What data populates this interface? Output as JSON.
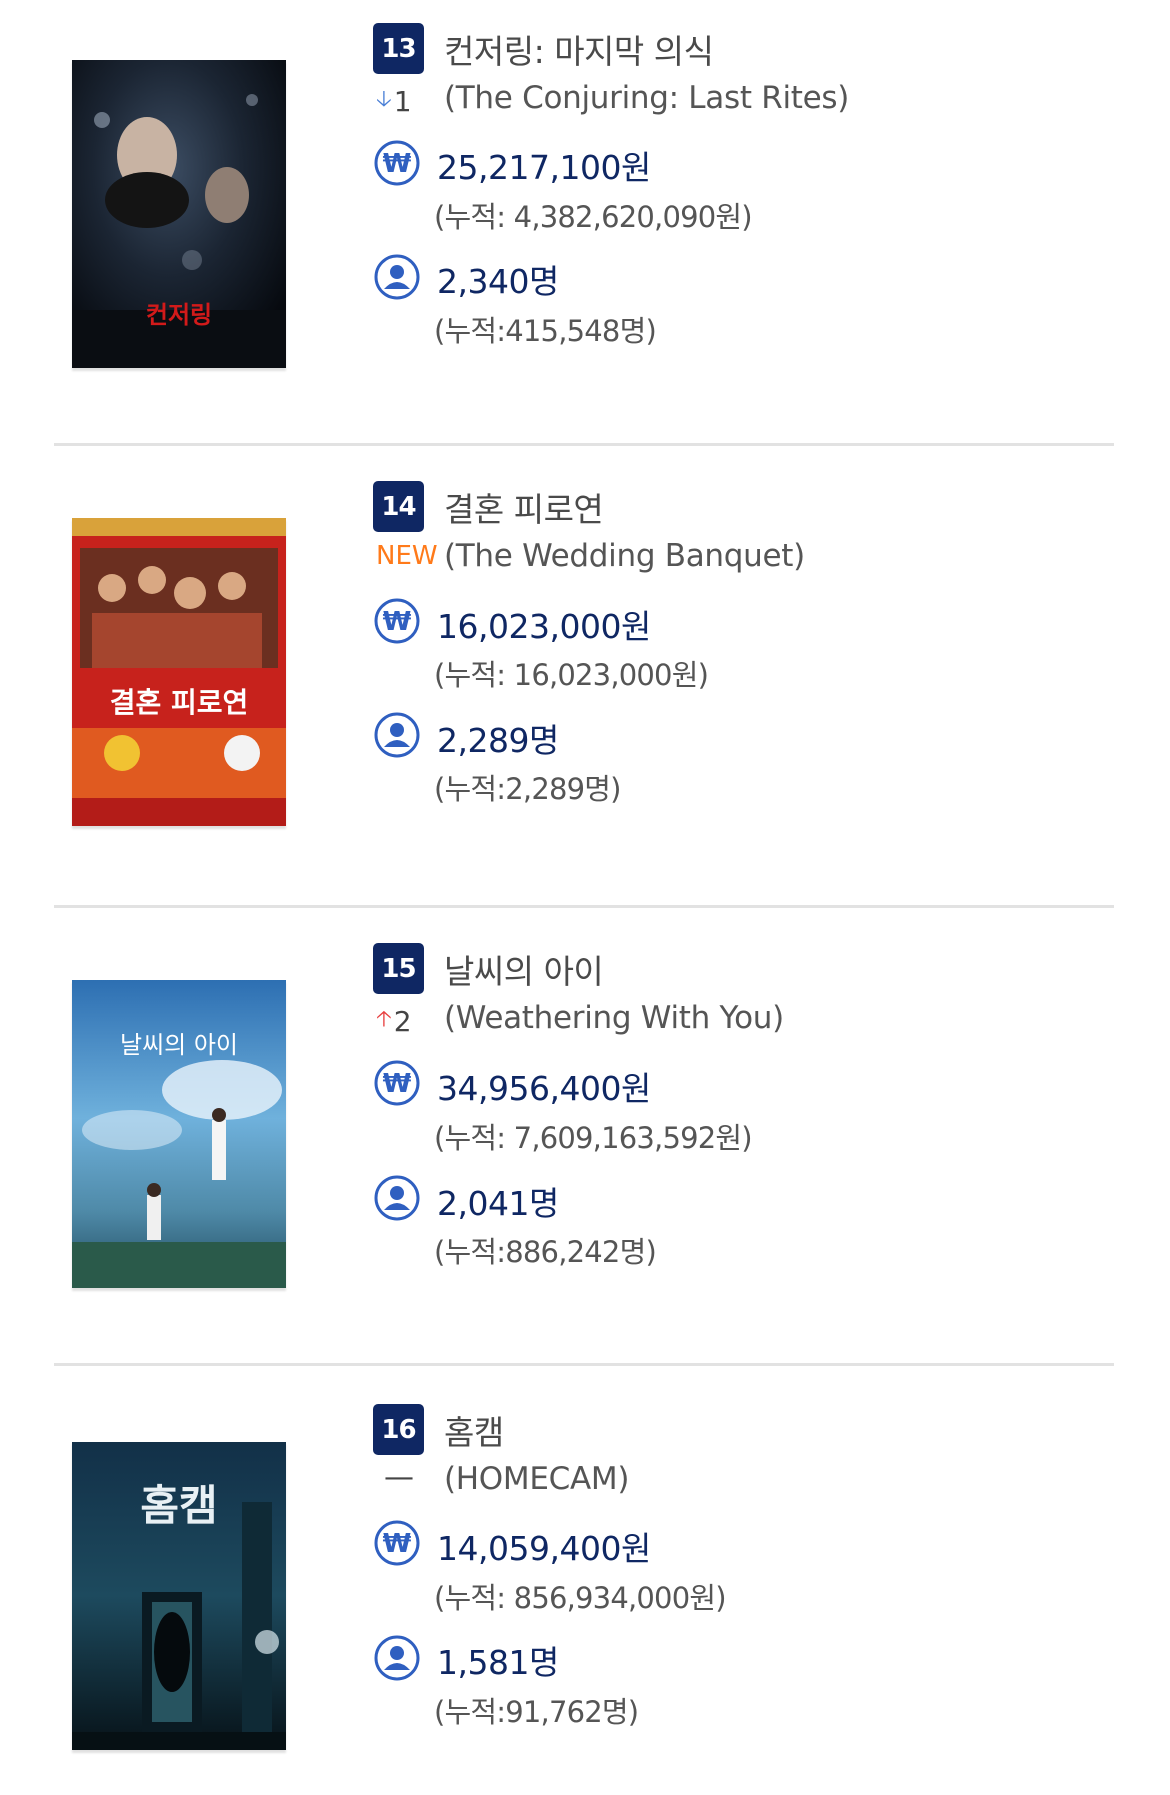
{
  "movies": [
    {
      "rank": "13",
      "korean_title": "컨저링: 마지막 의식",
      "english_title": "(The Conjuring: Last Rites)",
      "change": "1",
      "change_type": "down",
      "revenue": "25,217,100원",
      "revenue_cumulative": "(누적: 4,382,620,090원)",
      "audience": "2,340명",
      "audience_cumulative": "(누적:415,548명)",
      "poster_text": "컨저링"
    },
    {
      "rank": "14",
      "korean_title": "결혼 피로연",
      "english_title": "(The Wedding Banquet)",
      "change": "NEW",
      "change_type": "new",
      "revenue": "16,023,000원",
      "revenue_cumulative": "(누적: 16,023,000원)",
      "audience": "2,289명",
      "audience_cumulative": "(누적:2,289명)",
      "poster_text": "결혼 피로연"
    },
    {
      "rank": "15",
      "korean_title": "날씨의 아이",
      "english_title": "(Weathering With You)",
      "change": "2",
      "change_type": "up",
      "revenue": "34,956,400원",
      "revenue_cumulative": "(누적: 7,609,163,592원)",
      "audience": "2,041명",
      "audience_cumulative": "(누적:886,242명)",
      "poster_text": "날씨의 아이"
    },
    {
      "rank": "16",
      "korean_title": "홈캠",
      "english_title": "(HOMECAM)",
      "change": "—",
      "change_type": "same",
      "revenue": "14,059,400원",
      "revenue_cumulative": "(누적: 856,934,000원)",
      "audience": "1,581명",
      "audience_cumulative": "(누적:91,762명)",
      "poster_text": "홈캠"
    }
  ],
  "icons": {
    "revenue": "won-currency-icon",
    "audience": "person-icon",
    "down_arrow": "arrow-down-icon",
    "up_arrow": "arrow-up-icon"
  },
  "colors": {
    "rank_badge": "#0f2763",
    "value_text": "#0f2763",
    "new_badge": "#ff7a1a",
    "up_arrow": "#e84040",
    "down_arrow": "#4a7fd6",
    "icon_blue": "#2f5fc0"
  }
}
